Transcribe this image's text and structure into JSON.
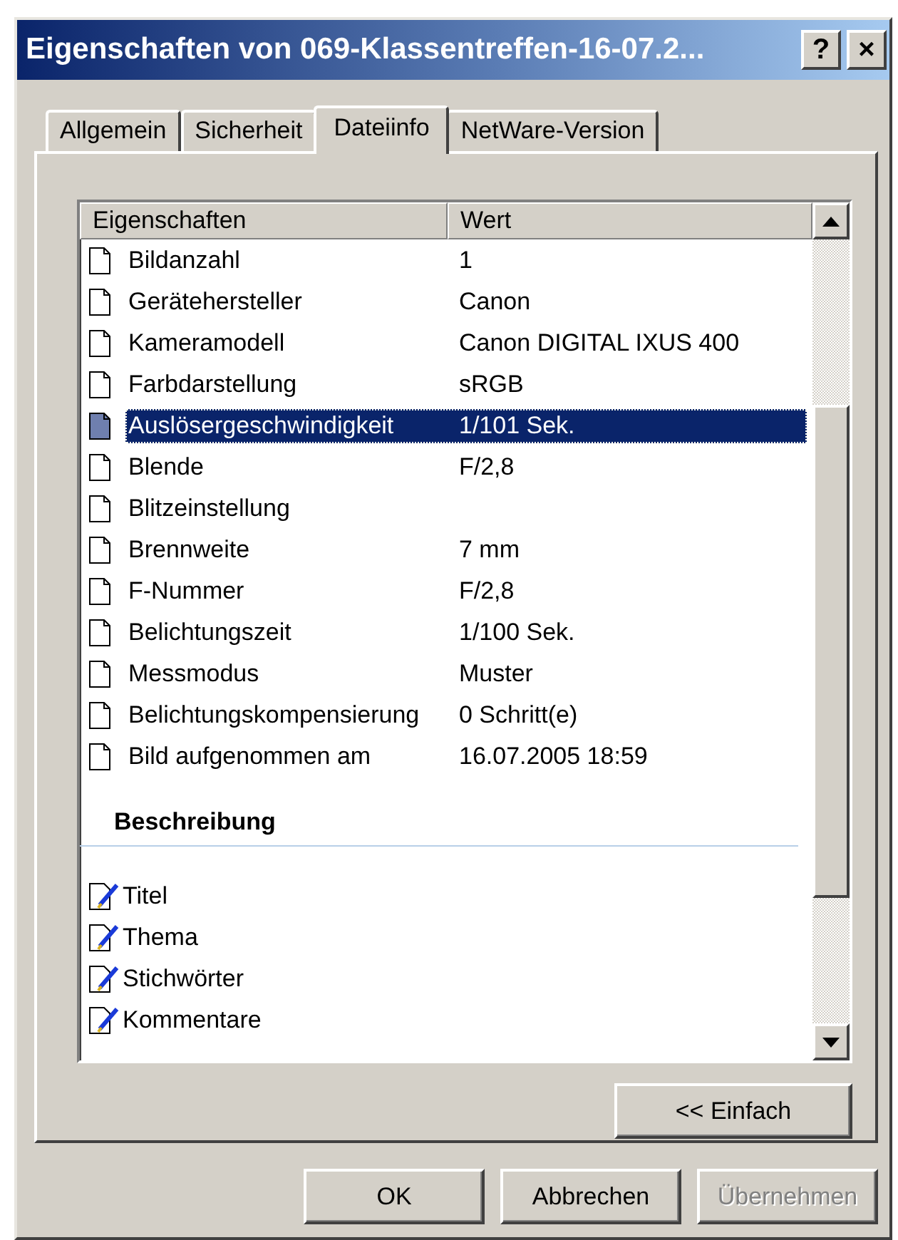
{
  "window": {
    "title": "Eigenschaften von 069-Klassentreffen-16-07.2...",
    "buttons": [
      "?",
      "×"
    ]
  },
  "tabs": [
    {
      "label": "Allgemein",
      "selected": false
    },
    {
      "label": "Sicherheit",
      "selected": false
    },
    {
      "label": "Dateiinfo",
      "selected": true
    },
    {
      "label": "NetWare-Version",
      "selected": false
    }
  ],
  "list": {
    "columns": [
      "Eigenschaften",
      "Wert"
    ],
    "rows": [
      {
        "name": "Bildanzahl",
        "value": "1",
        "selected": false
      },
      {
        "name": "Gerätehersteller",
        "value": "Canon",
        "selected": false
      },
      {
        "name": "Kameramodell",
        "value": "Canon DIGITAL IXUS 400",
        "selected": false
      },
      {
        "name": "Farbdarstellung",
        "value": "sRGB",
        "selected": false
      },
      {
        "name": "Auslösergeschwindigkeit",
        "value": "1/101 Sek.",
        "selected": true
      },
      {
        "name": "Blende",
        "value": "F/2,8",
        "selected": false
      },
      {
        "name": "Blitzeinstellung",
        "selected": false
      },
      {
        "name": "Brennweite",
        "value": "7 mm",
        "selected": false
      },
      {
        "name": "F-Nummer",
        "value": "F/2,8",
        "selected": false
      },
      {
        "name": "Belichtungszeit",
        "value": "1/100 Sek.",
        "selected": false
      },
      {
        "name": "Messmodus",
        "value": "Muster",
        "selected": false
      },
      {
        "name": "Belichtungskompensierung",
        "value": "0 Schritt(e)",
        "selected": false
      },
      {
        "name": "Bild aufgenommen am",
        "value": "16.07.2005 18:59",
        "selected": false
      }
    ],
    "section": {
      "heading": "Beschreibung",
      "items": [
        "Titel",
        "Thema",
        "Stichwörter",
        "Kommentare"
      ]
    }
  },
  "mode_button": {
    "label": "<< Einfach",
    "disabled": false
  },
  "buttons": [
    {
      "label": "OK",
      "disabled": false
    },
    {
      "label": "Abbrechen",
      "disabled": false
    },
    {
      "label": "Übernehmen",
      "disabled": true
    }
  ]
}
